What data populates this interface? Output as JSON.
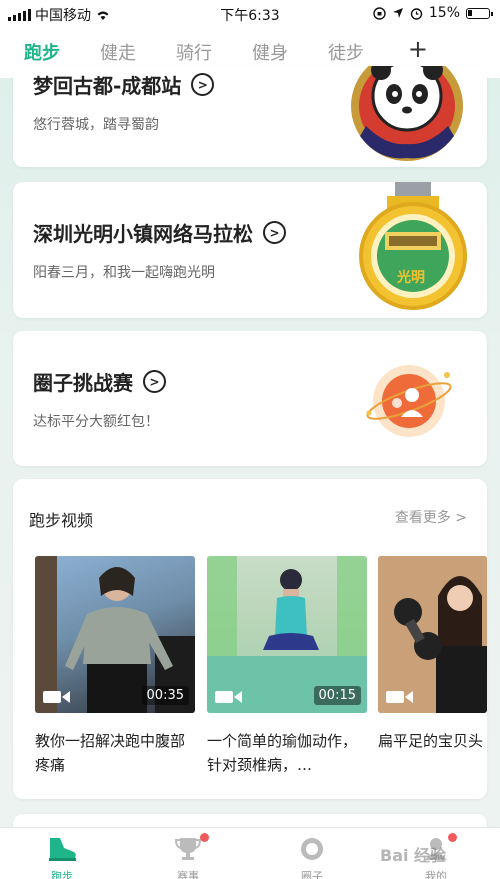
{
  "status_bar": {
    "carrier": "中国移动",
    "time": "下午6:33",
    "battery": "15%"
  },
  "tabs": [
    {
      "label": "跑步",
      "active": true
    },
    {
      "label": "健走",
      "active": false
    },
    {
      "label": "骑行",
      "active": false
    },
    {
      "label": "健身",
      "active": false
    },
    {
      "label": "徒步",
      "active": false
    }
  ],
  "tab_add_label": "+",
  "cards": [
    {
      "title": "梦回古都-成都站",
      "subtitle": "悠行蓉城，踏寻蜀韵",
      "badge": "panda-medal"
    },
    {
      "title": "深圳光明小镇网络马拉松",
      "subtitle": "阳春三月，和我一起嗨跑光明",
      "badge": "guangming-medal",
      "badge_text": "光明"
    },
    {
      "title": "圈子挑战赛",
      "subtitle": "达标平分大额红包！",
      "badge": "red-packet-icon"
    }
  ],
  "video_section": {
    "title": "跑步视频",
    "more": "查看更多",
    "videos": [
      {
        "duration": "00:35",
        "caption": "教你一招解决跑中腹部疼痛"
      },
      {
        "duration": "00:15",
        "caption": "一个简单的瑜伽动作，针对颈椎病，…"
      },
      {
        "duration": "",
        "caption": "扁平足的宝贝头"
      }
    ]
  },
  "bottom_nav": [
    {
      "label": "跑步",
      "icon": "running-shoe-icon",
      "active": true
    },
    {
      "label": "赛事",
      "icon": "trophy-icon",
      "active": false
    },
    {
      "label": "圈子",
      "icon": "circle-icon",
      "active": false
    },
    {
      "label": "我的",
      "icon": "profile-icon",
      "active": false
    }
  ],
  "watermark": "Bai 经验",
  "colors": {
    "accent": "#1fb58a",
    "badge_red": "#f05a5a"
  }
}
